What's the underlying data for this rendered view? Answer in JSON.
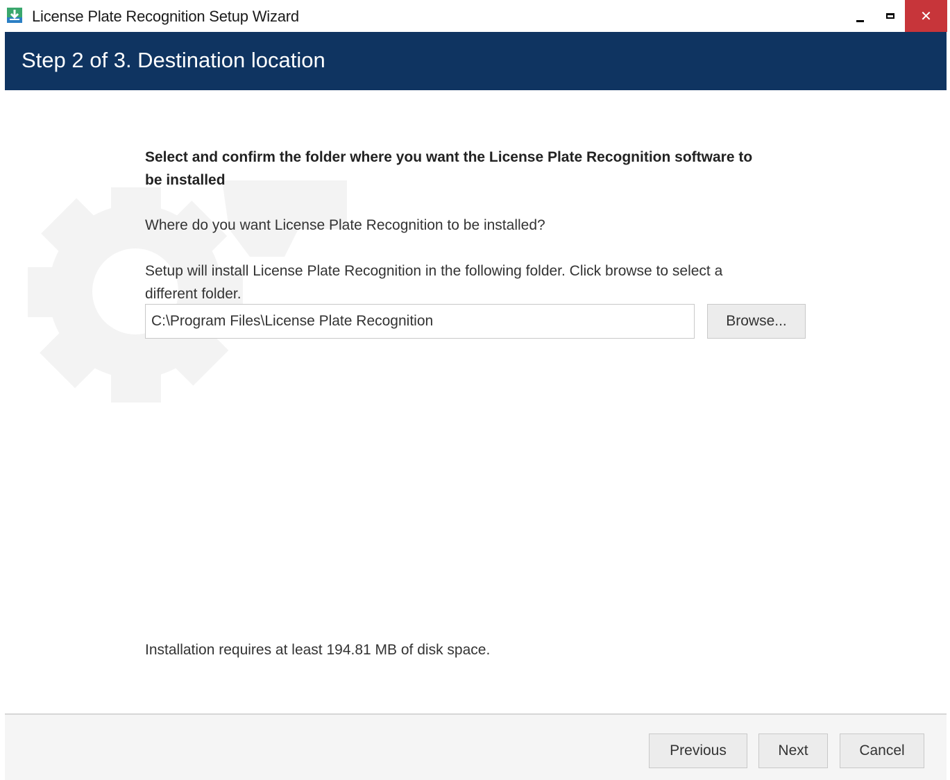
{
  "window": {
    "title": "License Plate Recognition Setup Wizard",
    "app_icon": "installer-download-icon",
    "controls": {
      "minimize_icon": "minimize-icon",
      "maximize_icon": "maximize-icon",
      "close_label": "✕"
    },
    "close_color": "#c7353a"
  },
  "header": {
    "title": "Step 2 of 3. Destination location",
    "background_color": "#0f3461"
  },
  "main": {
    "heading": "Select and confirm the folder where you want the License Plate Recognition software to be installed",
    "question": "Where do you want License Plate Recognition to be installed?",
    "instructions": "Setup will install License Plate Recognition in the following folder. Click browse to select a different folder.",
    "path_value": "C:\\Program Files\\License Plate Recognition",
    "browse_label": "Browse...",
    "disk_space": "Installation requires at least 194.81 MB of disk space."
  },
  "footer": {
    "previous_label": "Previous",
    "next_label": "Next",
    "cancel_label": "Cancel"
  }
}
